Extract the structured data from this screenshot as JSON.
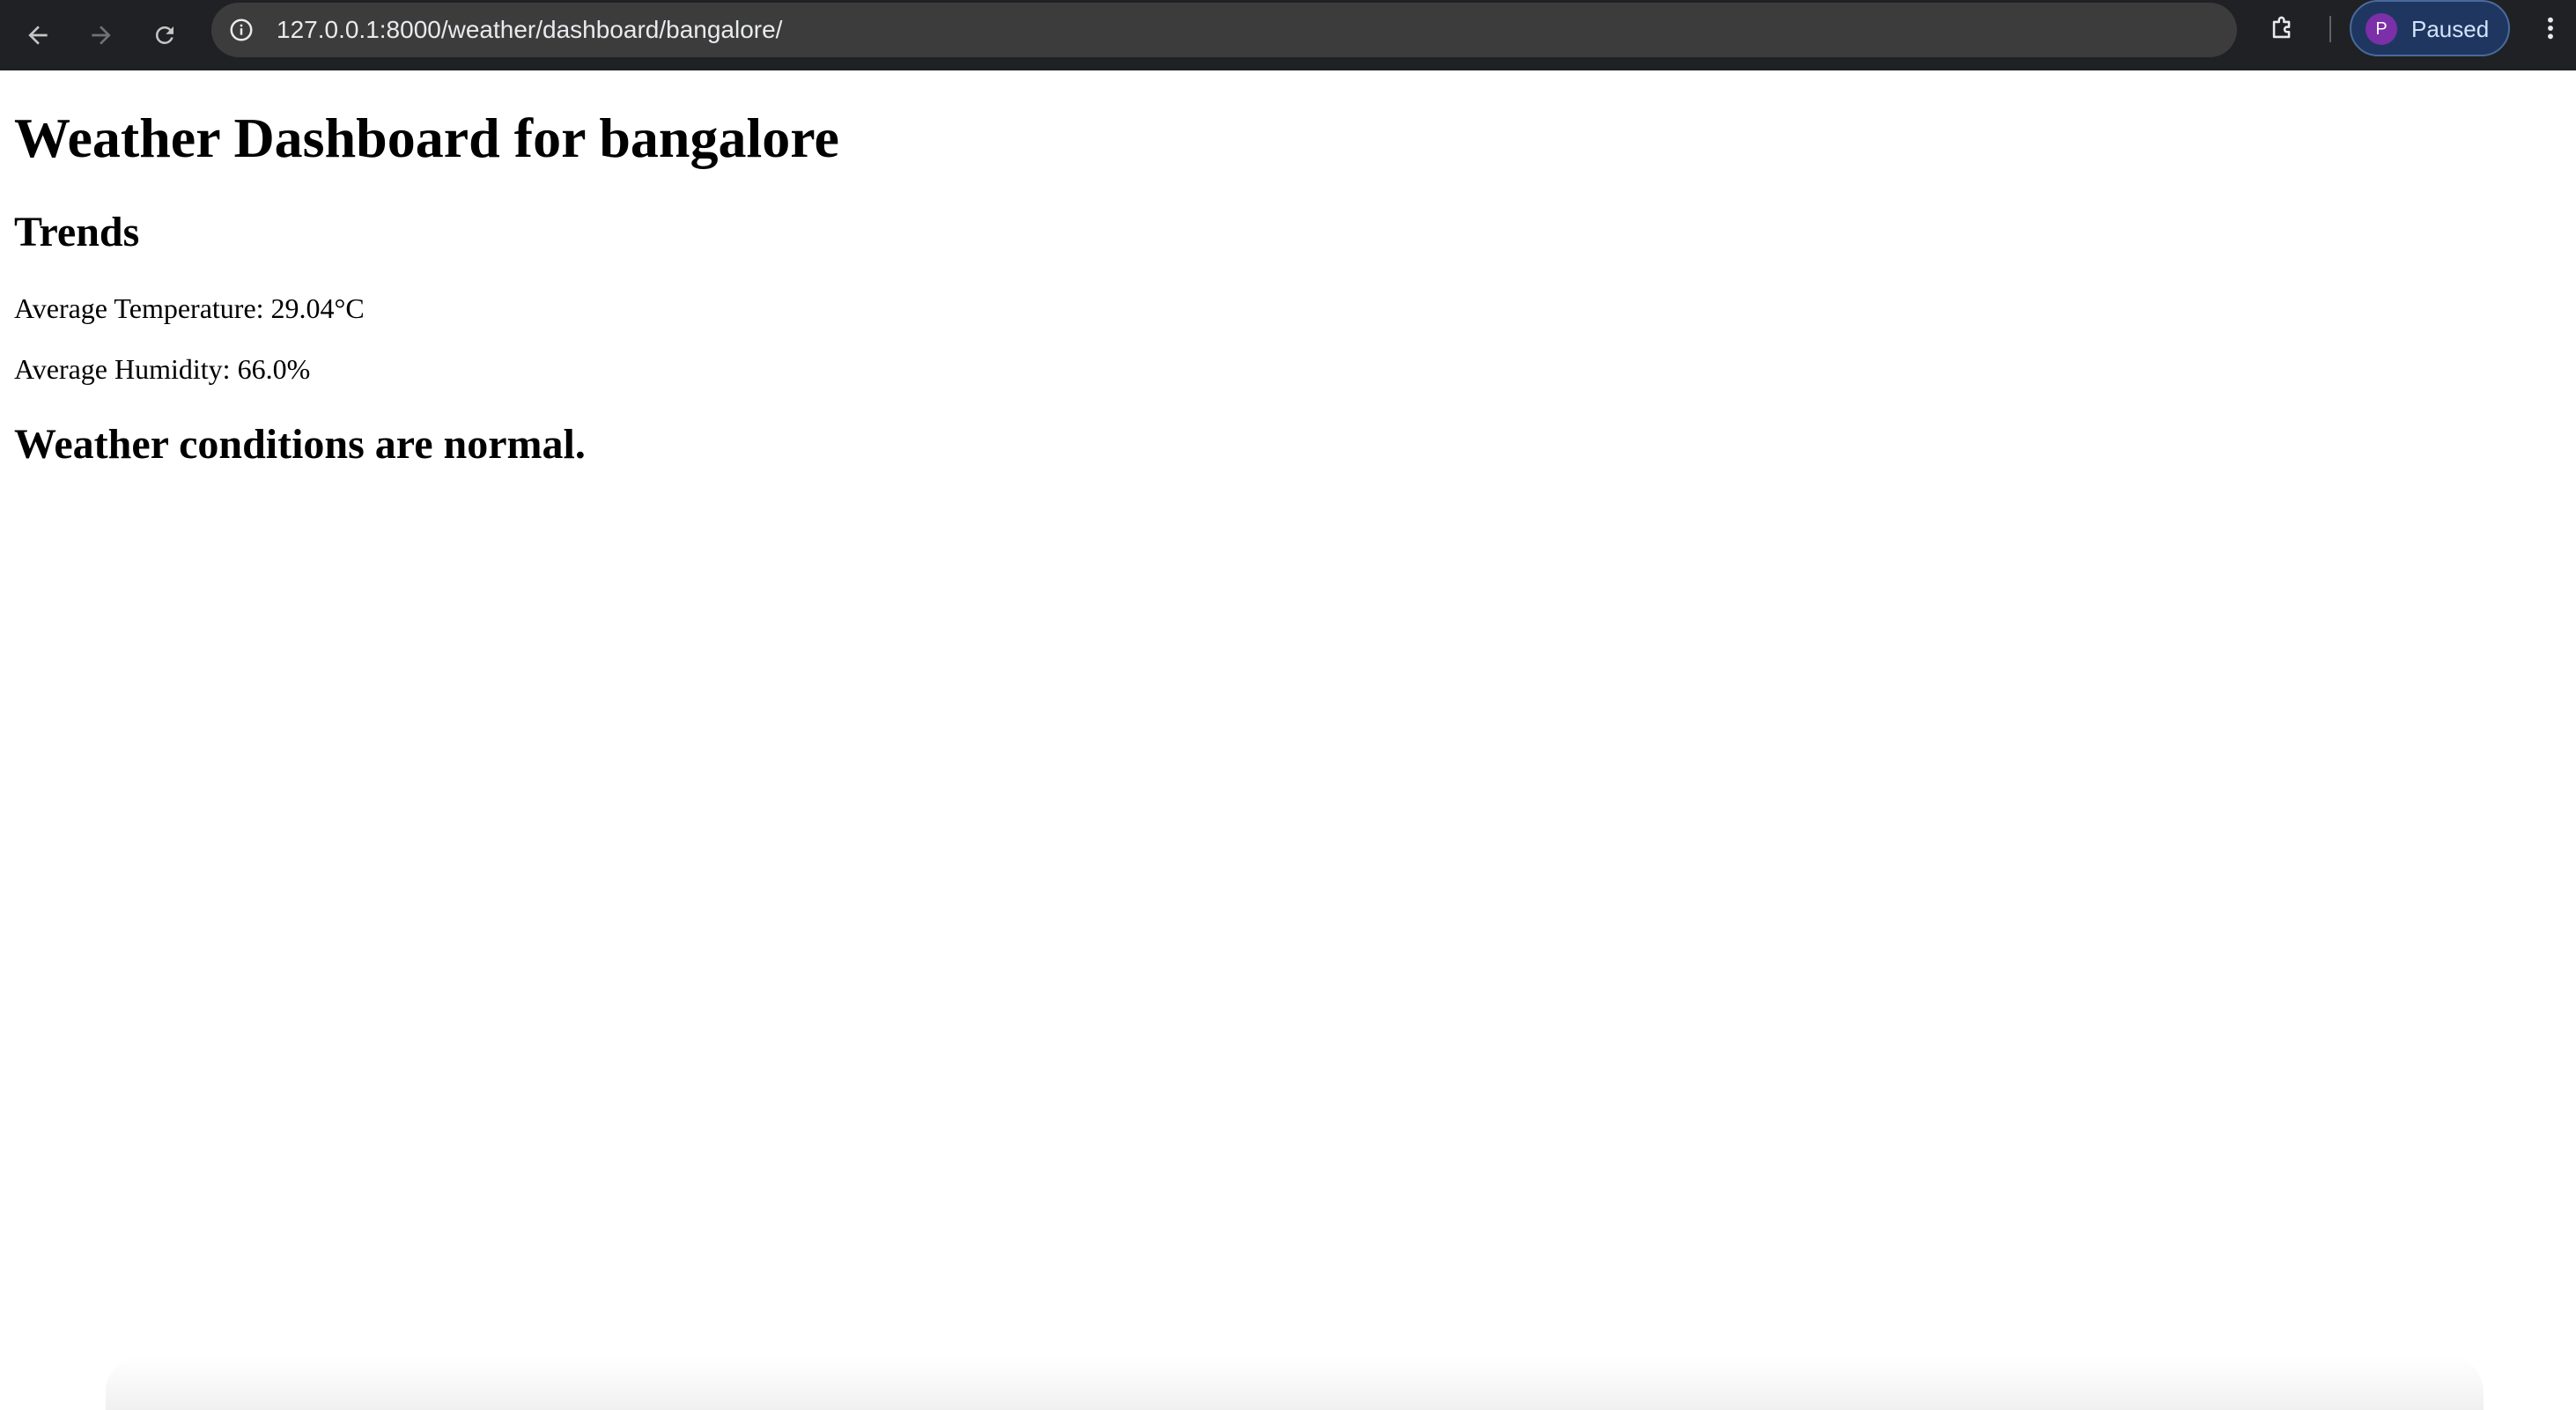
{
  "browser": {
    "url": "127.0.0.1:8000/weather/dashboard/bangalore/",
    "profile": {
      "initial": "P",
      "status": "Paused"
    },
    "icons": {
      "back": "arrow-left-icon",
      "forward": "arrow-right-icon",
      "reload": "reload-icon",
      "site_info": "info-icon",
      "bookmark": "star-icon",
      "extensions": "puzzle-icon",
      "menu": "kebab-menu-icon"
    },
    "colors": {
      "toolbar_bg": "#202124",
      "omnibox_bg": "#3c3c3c",
      "profile_chip_bg": "#1f3760",
      "avatar_bg": "#7b2fa8"
    }
  },
  "page": {
    "title": "Weather Dashboard for bangalore",
    "trends_heading": "Trends",
    "avg_temperature": "Average Temperature: 29.04°C",
    "avg_humidity": "Average Humidity: 66.0%",
    "status_message": "Weather conditions are normal."
  }
}
